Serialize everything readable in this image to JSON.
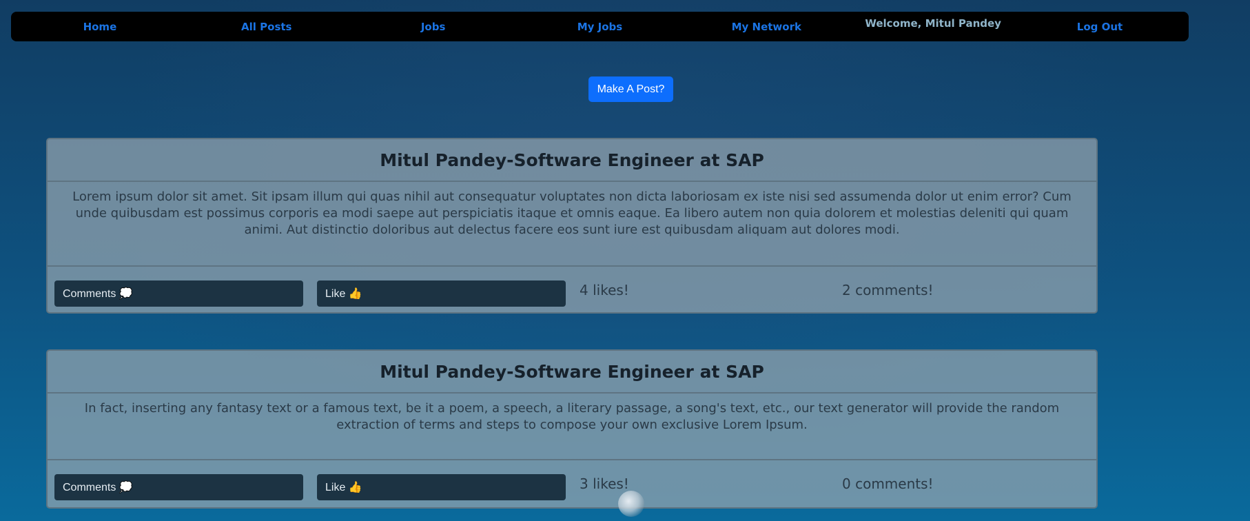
{
  "nav": {
    "home": "Home",
    "all_posts": "All Posts",
    "jobs": "Jobs",
    "my_jobs": "My Jobs",
    "my_network": "My Network",
    "welcome": "Welcome, Mitul Pandey",
    "logout": "Log Out"
  },
  "make_post_label": "Make A Post?",
  "posts": [
    {
      "author": "Mitul Pandey",
      "separator": "-",
      "title": "Software Engineer at SAP",
      "body": "Lorem ipsum dolor sit amet. Sit ipsam illum qui quas nihil aut consequatur voluptates non dicta laboriosam ex iste nisi sed assumenda dolor ut enim error? Cum unde quibusdam est possimus corporis ea modi saepe aut perspiciatis itaque et omnis eaque. Ea libero autem non quia dolorem et molestias deleniti qui quam animi. Aut distinctio doloribus aut delectus facere eos sunt iure est quibusdam aliquam aut dolores modi.",
      "comments_button": "Comments 💭",
      "like_button": "Like 👍",
      "likes": "4 likes!",
      "comments": "2 comments!"
    },
    {
      "author": "Mitul Pandey",
      "separator": "-",
      "title": "Software Engineer at SAP",
      "body": "In fact, inserting any fantasy text or a famous text, be it a poem, a speech, a literary passage, a song's text, etc., our text generator will provide the random extraction of terms and steps to compose your own exclusive Lorem Ipsum.",
      "comments_button": "Comments 💭",
      "like_button": "Like 👍",
      "likes": "3 likes!",
      "comments": "0 comments!"
    }
  ]
}
